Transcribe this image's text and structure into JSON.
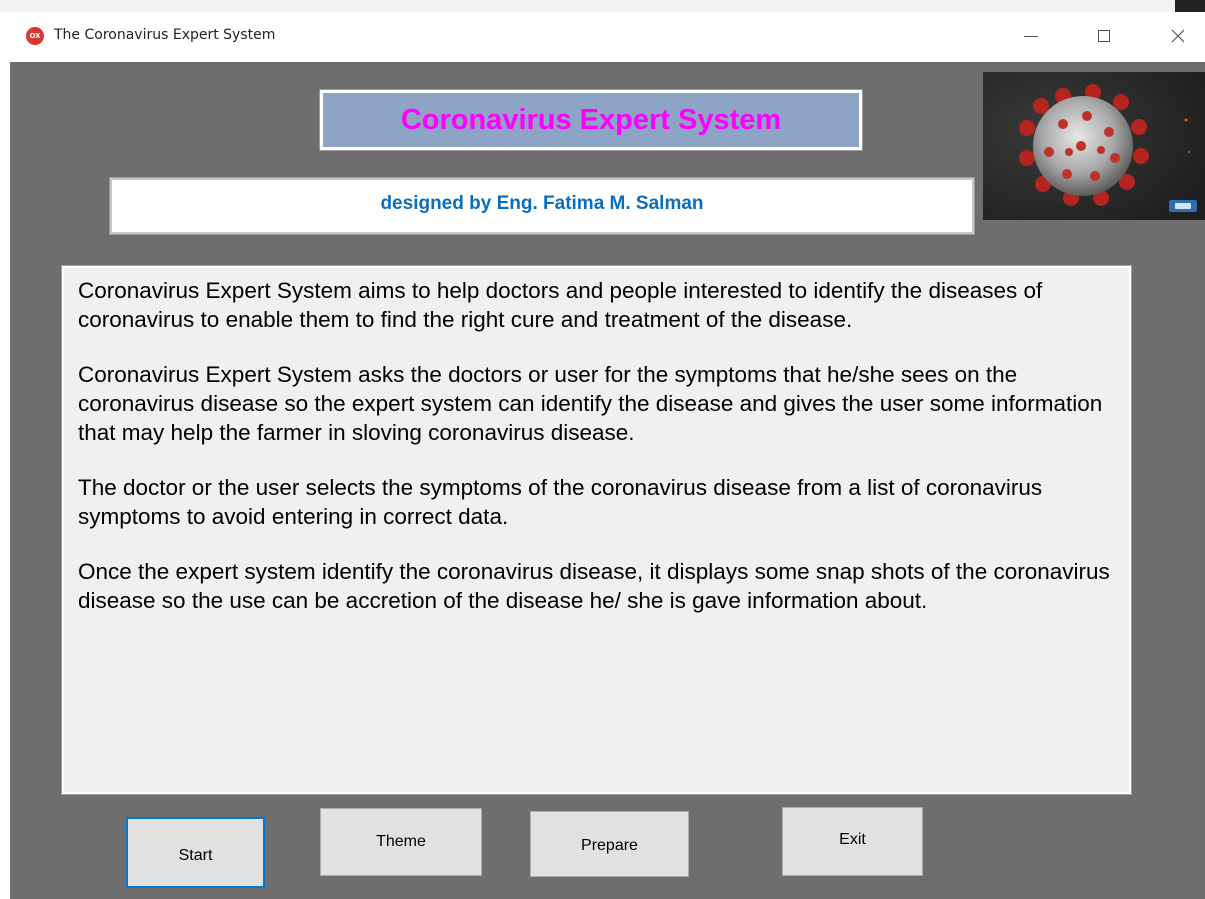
{
  "window": {
    "title": "The Coronavirus Expert System",
    "icon": "ox-app-icon",
    "controls": {
      "minimize": "minimize-icon",
      "maximize": "maximize-icon",
      "close": "close-icon"
    }
  },
  "header": {
    "title": "Coronavirus Expert System",
    "designer": "designed by Eng. Fatima M. Salman",
    "image": "coronavirus-image"
  },
  "description": {
    "paragraphs": [
      "Coronavirus Expert System aims to help doctors and people interested to identify the diseases of coronavirus to enable them to find the right cure and treatment of the disease.",
      "Coronavirus Expert System asks the doctors or user for the symptoms that he/she sees on the coronavirus disease so the expert system can identify the disease and gives the user some information that may help the farmer in sloving coronavirus disease.",
      "The doctor or the user selects the symptoms of the coronavirus disease from a list of coronavirus symptoms to avoid entering in correct data.",
      "Once the expert system identify the coronavirus disease, it displays some snap shots of the coronavirus disease so the use can be accretion of the disease he/ she is gave information about."
    ]
  },
  "buttons": {
    "start": "Start",
    "theme": "Theme",
    "prepare": "Prepare",
    "exit": "Exit"
  },
  "colors": {
    "title_text": "#ff00ff",
    "title_background": "#8ea4c6",
    "designer_text": "#0a6ebd",
    "client_background": "#6e6e6e",
    "description_background": "#f0f0f0",
    "focus_border": "#0078d7"
  }
}
